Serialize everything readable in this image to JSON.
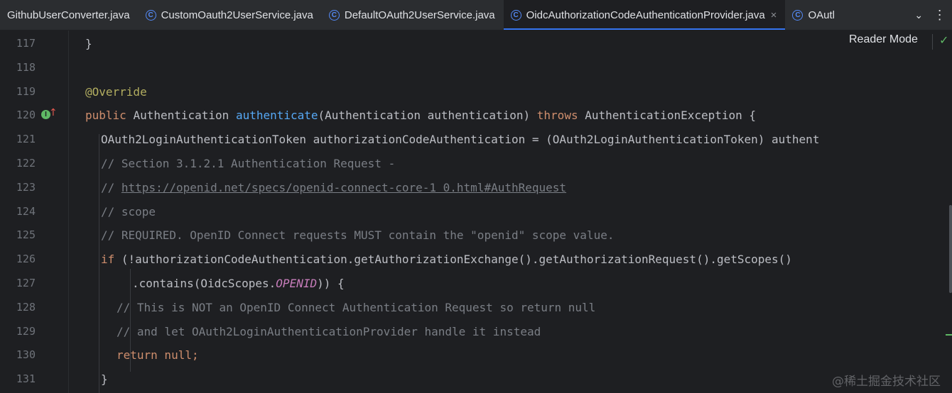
{
  "tabs": [
    {
      "label": "GithubUserConverter.java",
      "icon": "class-icon",
      "active": false
    },
    {
      "label": "CustomOauth2UserService.java",
      "icon": "class-icon",
      "active": false
    },
    {
      "label": "DefaultOAuth2UserService.java",
      "icon": "class-icon",
      "active": false
    },
    {
      "label": "OidcAuthorizationCodeAuthenticationProvider.java",
      "icon": "class-icon",
      "active": true,
      "close": "×"
    },
    {
      "label": "OAutl",
      "icon": "class-icon",
      "active": false
    }
  ],
  "tab_icon_glyph": "C",
  "tab_overflow": {
    "chevron": "⌄",
    "more": "⋮"
  },
  "toolbar": {
    "reader_mode": "Reader Mode",
    "status_check": "✓"
  },
  "gutter": {
    "implements_badge": "I",
    "override_arrow": "↑"
  },
  "lines": [
    {
      "num": "117",
      "indent": "    ",
      "t": [
        [
          "}",
          ""
        ]
      ]
    },
    {
      "num": "118",
      "indent": "",
      "t": []
    },
    {
      "num": "119",
      "indent": "    ",
      "t": [
        [
          "@Override",
          "ann"
        ]
      ]
    },
    {
      "num": "120",
      "indent": "    ",
      "t": [
        [
          "public ",
          "kw"
        ],
        [
          "Authentication ",
          ""
        ],
        [
          "authenticate",
          "fn"
        ],
        [
          "(Authentication authentication) ",
          ""
        ],
        [
          "throws ",
          "kw"
        ],
        [
          "AuthenticationException {",
          ""
        ]
      ]
    },
    {
      "num": "121",
      "indent": "        ",
      "t": [
        [
          "OAuth2LoginAuthenticationToken authorizationCodeAuthentication = (OAuth2LoginAuthenticationToken) authent",
          ""
        ]
      ]
    },
    {
      "num": "122",
      "indent": "        ",
      "t": [
        [
          "// Section 3.1.2.1 Authentication Request -",
          "cmt"
        ]
      ]
    },
    {
      "num": "123",
      "indent": "        ",
      "t": [
        [
          "// ",
          "cmt"
        ],
        [
          "https://openid.net/specs/openid-connect-core-1 0.html#AuthRequest",
          "cmt link"
        ]
      ]
    },
    {
      "num": "124",
      "indent": "        ",
      "t": [
        [
          "// scope",
          "cmt"
        ]
      ]
    },
    {
      "num": "125",
      "indent": "        ",
      "t": [
        [
          "// REQUIRED. OpenID Connect requests MUST contain the \"openid\" scope value.",
          "cmt"
        ]
      ]
    },
    {
      "num": "126",
      "indent": "        ",
      "t": [
        [
          "if ",
          "kw"
        ],
        [
          "(!authorizationCodeAuthentication.getAuthorizationExchange().getAuthorizationRequest().getScopes()",
          ""
        ]
      ]
    },
    {
      "num": "127",
      "indent": "                ",
      "t": [
        [
          ".contains(OidcScopes.",
          ""
        ],
        [
          "OPENID",
          "const"
        ],
        [
          ")) {",
          ""
        ]
      ]
    },
    {
      "num": "128",
      "indent": "            ",
      "t": [
        [
          "// This is NOT an OpenID Connect Authentication Request so return null",
          "cmt"
        ]
      ]
    },
    {
      "num": "129",
      "indent": "            ",
      "t": [
        [
          "// and let OAuth2LoginAuthenticationProvider handle it instead",
          "cmt"
        ]
      ]
    },
    {
      "num": "130",
      "indent": "            ",
      "t": [
        [
          "return null;",
          "kw"
        ]
      ]
    },
    {
      "num": "131",
      "indent": "        ",
      "t": [
        [
          "}",
          ""
        ]
      ]
    }
  ],
  "watermark": "@稀土掘金技术社区"
}
